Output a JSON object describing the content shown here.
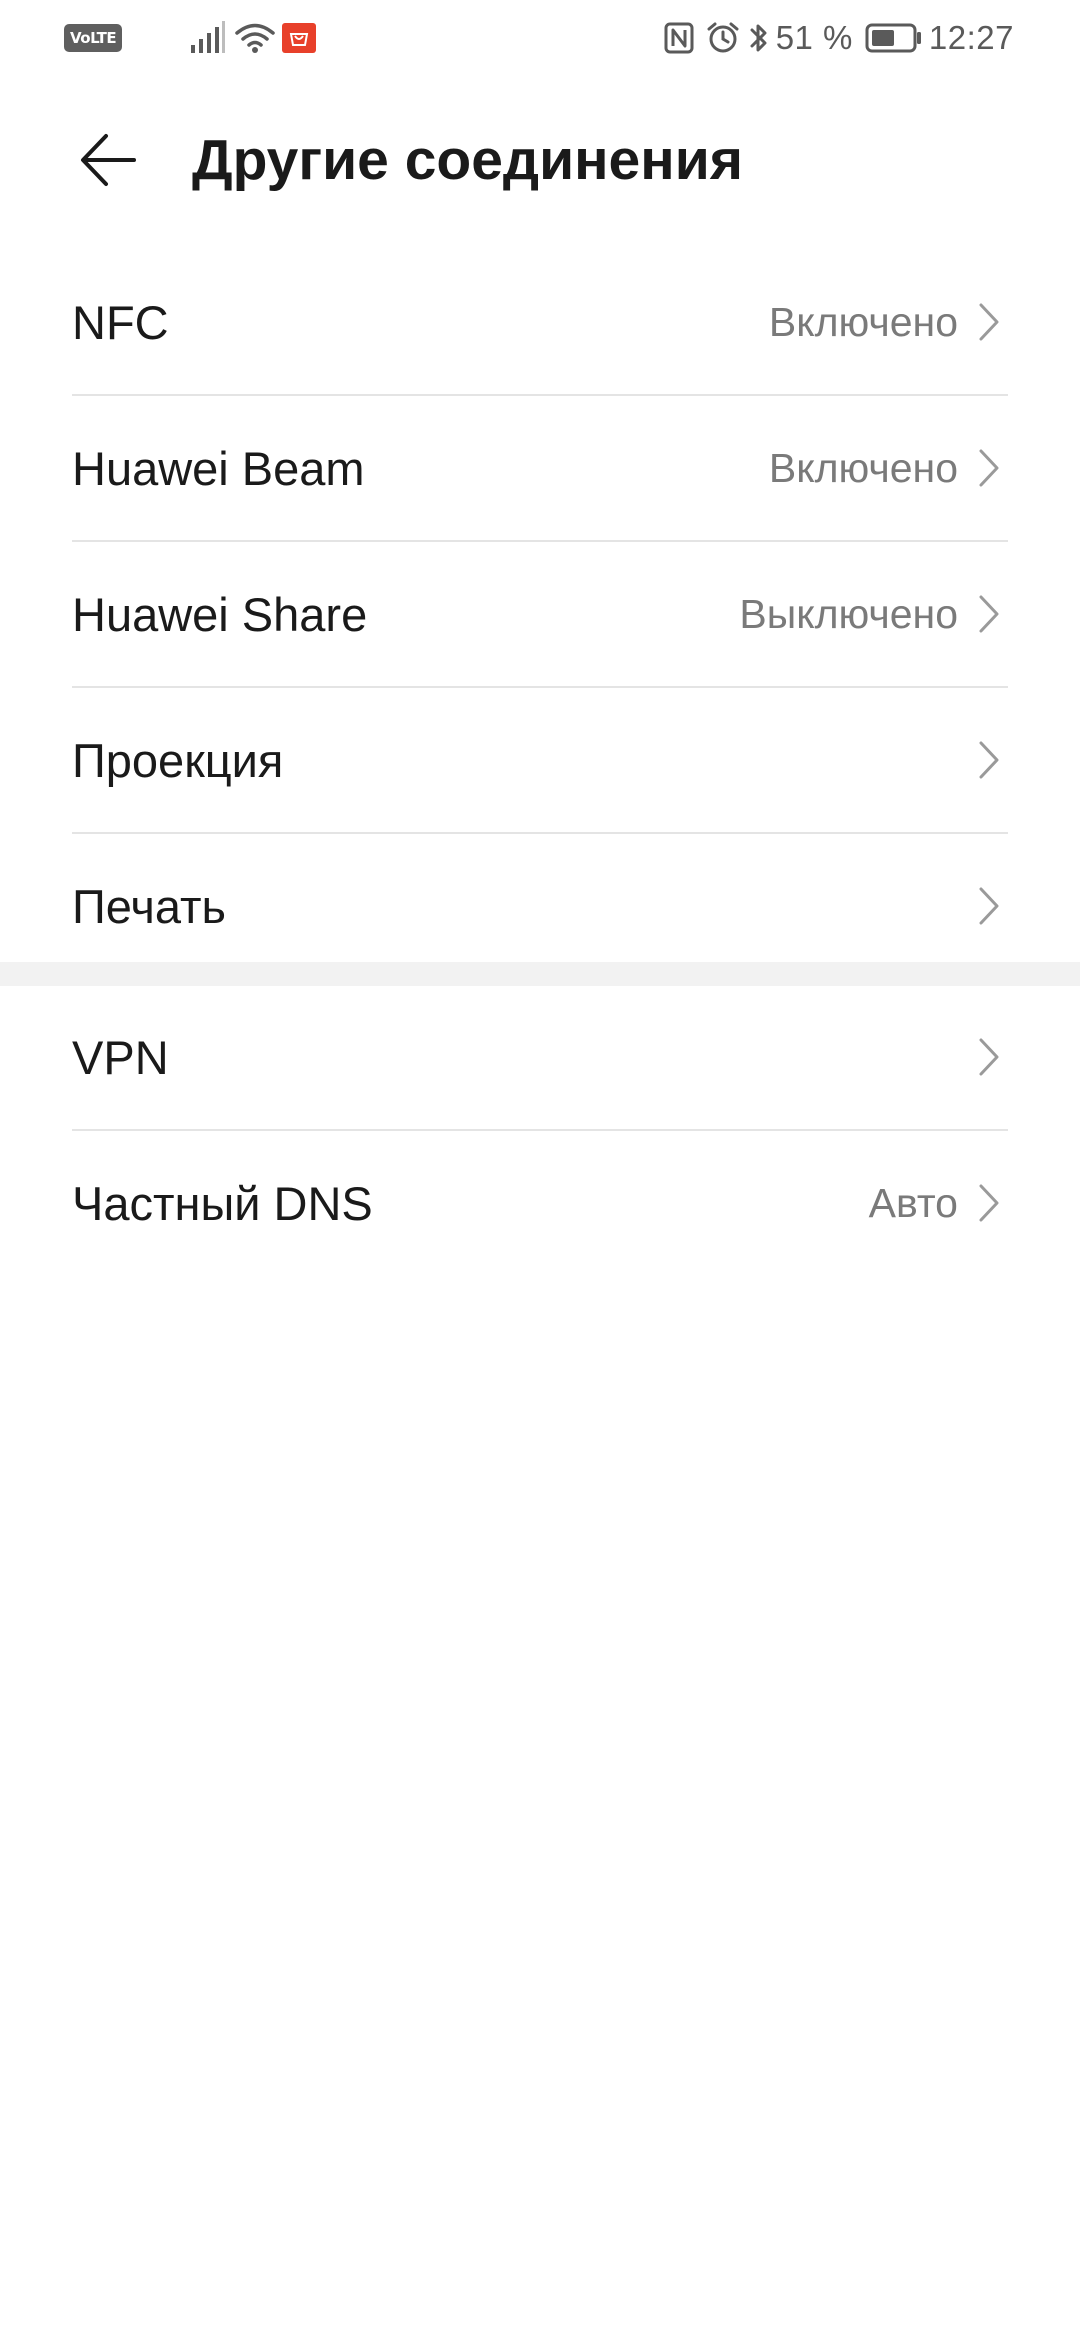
{
  "status_bar": {
    "volte_label": "VoLTE",
    "battery_percent": "51 %",
    "time": "12:27",
    "icon_color": "#5a5a5a"
  },
  "header": {
    "title": "Другие соединения",
    "back_icon": "arrow-left-icon"
  },
  "list": {
    "groups": [
      {
        "items": [
          {
            "label": "NFC",
            "value": "Включено"
          },
          {
            "label": "Huawei Beam",
            "value": "Включено"
          },
          {
            "label": "Huawei Share",
            "value": "Выключено"
          },
          {
            "label": "Проекция",
            "value": ""
          },
          {
            "label": "Печать",
            "value": ""
          }
        ]
      },
      {
        "items": [
          {
            "label": "VPN",
            "value": ""
          },
          {
            "label": "Частный DNS",
            "value": "Авто"
          }
        ]
      }
    ]
  },
  "colors": {
    "background": "#ffffff",
    "primary_text": "#1a1a1a",
    "secondary_text": "#7a7a7a",
    "divider": "#e4e4e4",
    "section_gap": "#f2f2f2"
  }
}
